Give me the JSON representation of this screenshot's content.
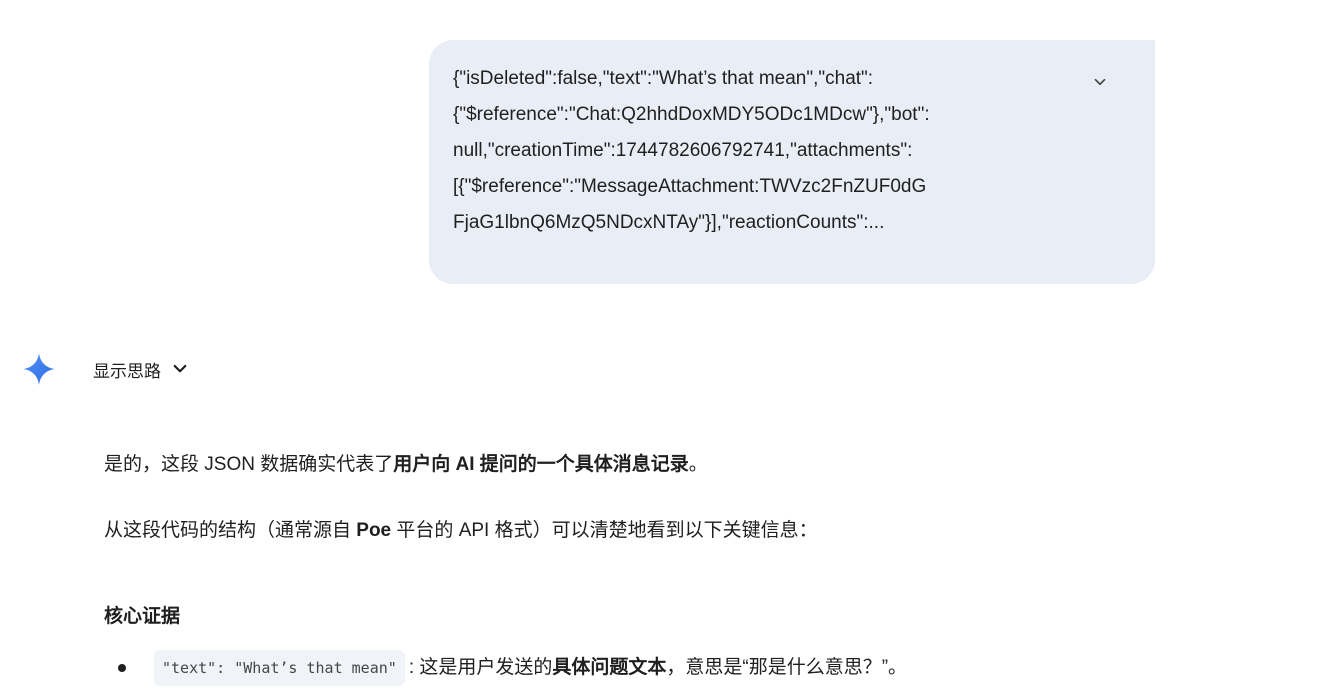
{
  "user_message": {
    "text": "{\"isDeleted\":false,\"text\":\"What’s that mean\",\"chat\":\n{\"$reference\":\"Chat:Q2hhdDoxMDY5ODc1MDcw\"},\"bot\":\nnull,\"creationTime\":1744782606792741,\"attachments\":\n[{\"$reference\":\"MessageAttachment:TWVzc2FnZUF0dG\nFjaG1lbnQ6MzQ5NDcxNTAy\"}],\"reactionCounts\":...",
    "expand_icon": "chevron-down-icon"
  },
  "response_header": {
    "logo_icon": "gemini-sparkle-icon",
    "thoughts_label": "显示思路",
    "thoughts_icon": "chevron-down-icon"
  },
  "response": {
    "p1_prefix": "是的，这段 JSON 数据确实代表了",
    "p1_bold": "用户向 AI 提问的一个具体消息记录",
    "p1_suffix": "。",
    "p2_prefix": "从这段代码的结构（通常源自 ",
    "p2_bold": "Poe",
    "p2_suffix": " 平台的 API 格式）可以清楚地看到以下关键信息：",
    "heading": "核心证据",
    "bullet1_code": "\"text\": \"What’s that mean\"",
    "bullet1_prefix": ": 这是用户发送的",
    "bullet1_bold": "具体问题文本",
    "bullet1_suffix": "，意思是“那是什么意思？”。"
  },
  "colors": {
    "bubble_bg": "#e9eef6",
    "code_bg": "#f0f4f9",
    "text": "#1f1f1f",
    "gemini_blue": "#4285f4"
  }
}
